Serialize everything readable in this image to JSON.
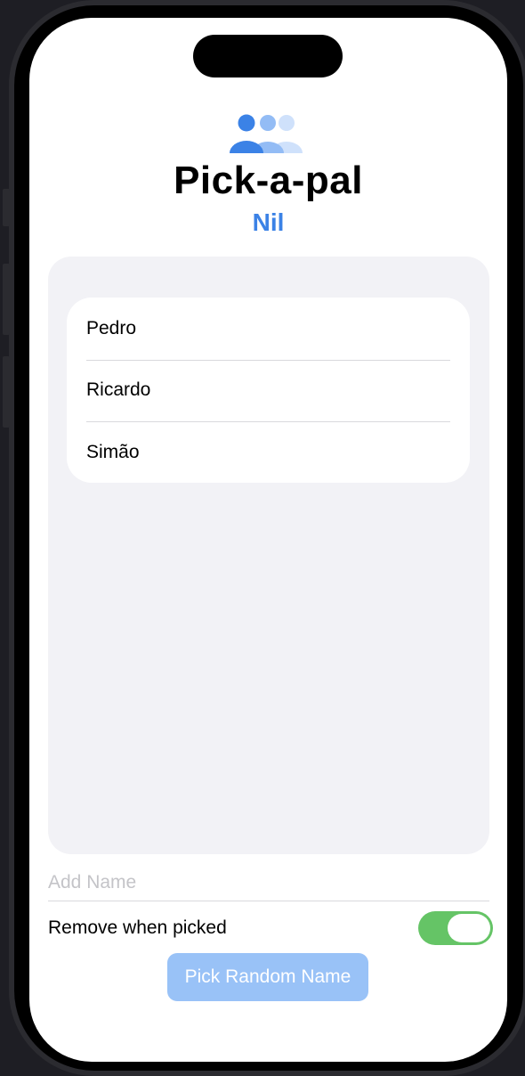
{
  "app": {
    "title": "Pick-a-pal",
    "picked_name": "Nil",
    "icon": "person-3-icon",
    "accent_color": "#3b82e6"
  },
  "names_list": {
    "items": [
      "Pedro",
      "Ricardo",
      "Simão"
    ]
  },
  "add_name": {
    "placeholder": "Add Name",
    "value": ""
  },
  "remove_when_picked": {
    "label": "Remove when picked",
    "enabled": true,
    "on_color": "#65c466"
  },
  "pick_button": {
    "label": "Pick Random Name",
    "disabled": true
  }
}
